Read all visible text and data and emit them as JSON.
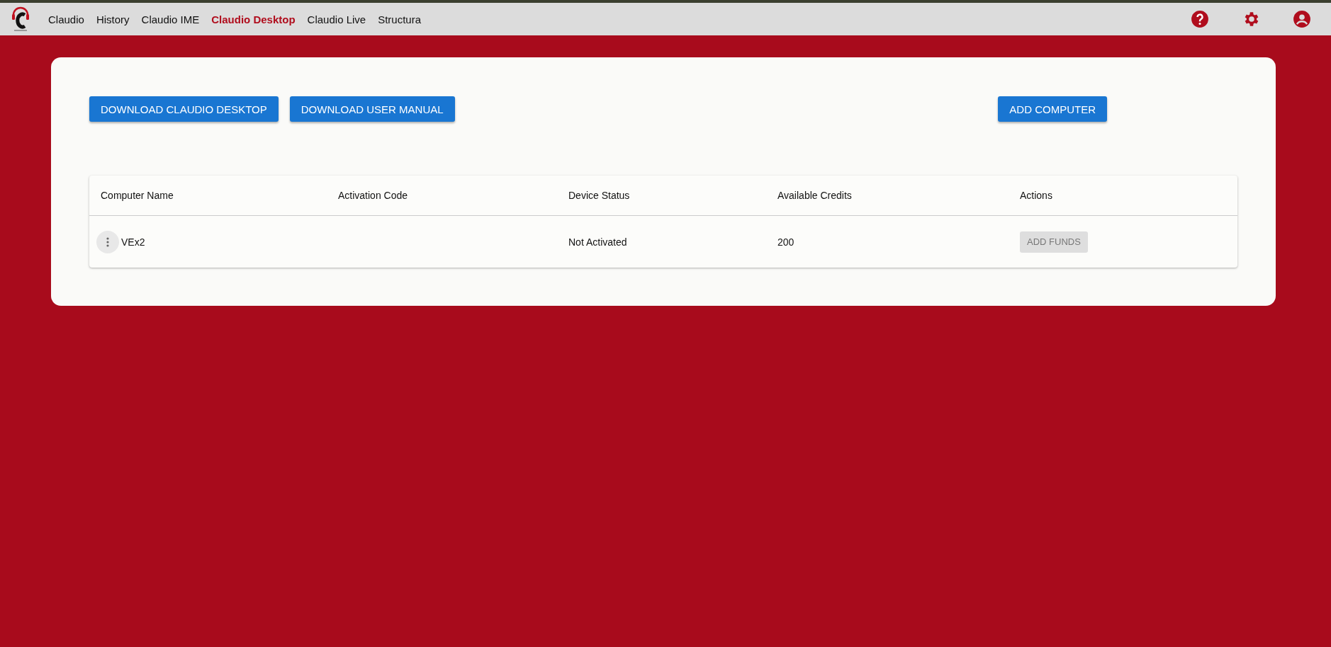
{
  "nav": {
    "items": [
      {
        "label": "Claudio",
        "selected": false
      },
      {
        "label": "History",
        "selected": false
      },
      {
        "label": "Claudio IME",
        "selected": false
      },
      {
        "label": "Claudio Desktop",
        "selected": true
      },
      {
        "label": "Claudio Live",
        "selected": false
      },
      {
        "label": "Structura",
        "selected": false
      }
    ]
  },
  "toolbar": {
    "buttons": [
      "DOWNLOAD CLAUDIO DESKTOP",
      "DOWNLOAD USER MANUAL"
    ],
    "add_button": "ADD COMPUTER"
  },
  "table": {
    "columns": [
      "Computer Name",
      "Activation Code",
      "Device Status",
      "Available Credits",
      "Actions"
    ],
    "rows": [
      {
        "name": "VEx2",
        "activation_code": "",
        "status": "Not Activated",
        "credits": "200",
        "action": "ADD FUNDS",
        "action_disabled": true
      }
    ]
  }
}
